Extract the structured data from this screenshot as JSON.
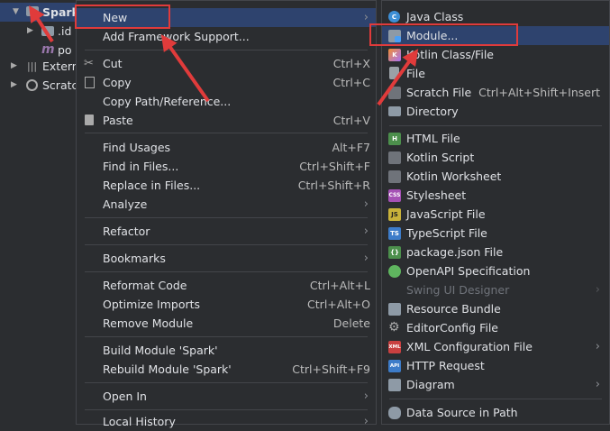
{
  "tree": {
    "project": "Spark",
    "idea": ".id",
    "pom": "po",
    "external": "Extern",
    "scratches": "Scratc"
  },
  "menu1": {
    "new": "New",
    "add_framework": "Add Framework Support...",
    "cut": "Cut",
    "cut_sc": "Ctrl+X",
    "copy": "Copy",
    "copy_sc": "Ctrl+C",
    "copy_path": "Copy Path/Reference...",
    "paste": "Paste",
    "paste_sc": "Ctrl+V",
    "find_usages": "Find Usages",
    "find_usages_sc": "Alt+F7",
    "find_in_files": "Find in Files...",
    "find_in_files_sc": "Ctrl+Shift+F",
    "replace_in_files": "Replace in Files...",
    "replace_in_files_sc": "Ctrl+Shift+R",
    "analyze": "Analyze",
    "refactor": "Refactor",
    "bookmarks": "Bookmarks",
    "reformat": "Reformat Code",
    "reformat_sc": "Ctrl+Alt+L",
    "optimize": "Optimize Imports",
    "optimize_sc": "Ctrl+Alt+O",
    "remove_module": "Remove Module",
    "remove_module_sc": "Delete",
    "build_module": "Build Module 'Spark'",
    "rebuild_module": "Rebuild Module 'Spark'",
    "rebuild_module_sc": "Ctrl+Shift+F9",
    "open_in": "Open In",
    "local_history": "Local History"
  },
  "menu2": {
    "java_class": "Java Class",
    "module": "Module...",
    "kotlin_class": "Kotlin Class/File",
    "file": "File",
    "scratch": "Scratch File",
    "scratch_sc": "Ctrl+Alt+Shift+Insert",
    "directory": "Directory",
    "html": "HTML File",
    "kotlin_script": "Kotlin Script",
    "kotlin_worksheet": "Kotlin Worksheet",
    "stylesheet": "Stylesheet",
    "js_file": "JavaScript File",
    "ts_file": "TypeScript File",
    "package_json": "package.json File",
    "openapi": "OpenAPI Specification",
    "swing": "Swing UI Designer",
    "resource_bundle": "Resource Bundle",
    "editorconfig": "EditorConfig File",
    "xml_config": "XML Configuration File",
    "http_request": "HTTP Request",
    "diagram": "Diagram",
    "datasource": "Data Source in Path"
  },
  "icon_badges": {
    "java": "C",
    "kotlin": "K",
    "html": "H",
    "css": "CSS",
    "js": "JS",
    "ts": "TS",
    "json": "{}",
    "xml": "XML",
    "api": "API"
  },
  "colors": {
    "background": "#2b2d30",
    "selection": "#2e436e",
    "separator": "#43454a",
    "annotation": "#e03b3b"
  }
}
